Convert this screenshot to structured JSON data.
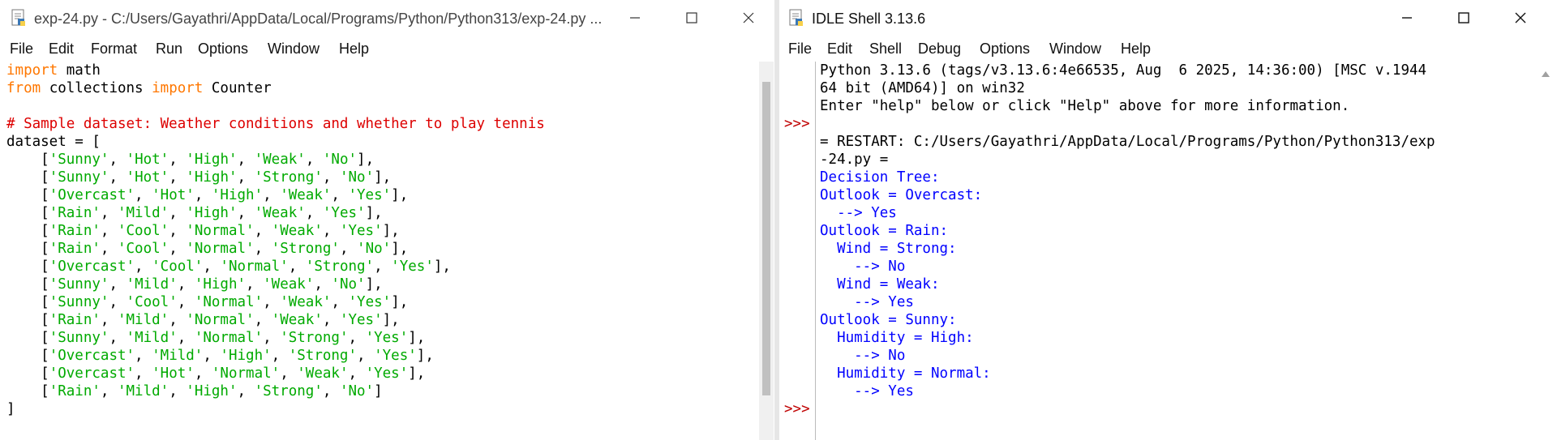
{
  "editor": {
    "title": "exp-24.py - C:/Users/Gayathri/AppData/Local/Programs/Python/Python313/exp-24.py ...",
    "menu": [
      "File",
      "Edit",
      "Format",
      "Run",
      "Options",
      "Window",
      "Help"
    ],
    "code_lines": [
      [
        {
          "t": "import",
          "c": "kw"
        },
        {
          "t": " math",
          "c": "def"
        }
      ],
      [
        {
          "t": "from",
          "c": "kw"
        },
        {
          "t": " collections ",
          "c": "def"
        },
        {
          "t": "import",
          "c": "kw"
        },
        {
          "t": " Counter",
          "c": "def"
        }
      ],
      [],
      [
        {
          "t": "# Sample dataset: Weather conditions and whether to play tennis",
          "c": "cm"
        }
      ],
      [
        {
          "t": "dataset = [",
          "c": "def"
        }
      ],
      [
        {
          "t": "    [",
          "c": "def"
        },
        {
          "t": "'Sunny'",
          "c": "str"
        },
        {
          "t": ", ",
          "c": "def"
        },
        {
          "t": "'Hot'",
          "c": "str"
        },
        {
          "t": ", ",
          "c": "def"
        },
        {
          "t": "'High'",
          "c": "str"
        },
        {
          "t": ", ",
          "c": "def"
        },
        {
          "t": "'Weak'",
          "c": "str"
        },
        {
          "t": ", ",
          "c": "def"
        },
        {
          "t": "'No'",
          "c": "str"
        },
        {
          "t": "],",
          "c": "def"
        }
      ],
      [
        {
          "t": "    [",
          "c": "def"
        },
        {
          "t": "'Sunny'",
          "c": "str"
        },
        {
          "t": ", ",
          "c": "def"
        },
        {
          "t": "'Hot'",
          "c": "str"
        },
        {
          "t": ", ",
          "c": "def"
        },
        {
          "t": "'High'",
          "c": "str"
        },
        {
          "t": ", ",
          "c": "def"
        },
        {
          "t": "'Strong'",
          "c": "str"
        },
        {
          "t": ", ",
          "c": "def"
        },
        {
          "t": "'No'",
          "c": "str"
        },
        {
          "t": "],",
          "c": "def"
        }
      ],
      [
        {
          "t": "    [",
          "c": "def"
        },
        {
          "t": "'Overcast'",
          "c": "str"
        },
        {
          "t": ", ",
          "c": "def"
        },
        {
          "t": "'Hot'",
          "c": "str"
        },
        {
          "t": ", ",
          "c": "def"
        },
        {
          "t": "'High'",
          "c": "str"
        },
        {
          "t": ", ",
          "c": "def"
        },
        {
          "t": "'Weak'",
          "c": "str"
        },
        {
          "t": ", ",
          "c": "def"
        },
        {
          "t": "'Yes'",
          "c": "str"
        },
        {
          "t": "],",
          "c": "def"
        }
      ],
      [
        {
          "t": "    [",
          "c": "def"
        },
        {
          "t": "'Rain'",
          "c": "str"
        },
        {
          "t": ", ",
          "c": "def"
        },
        {
          "t": "'Mild'",
          "c": "str"
        },
        {
          "t": ", ",
          "c": "def"
        },
        {
          "t": "'High'",
          "c": "str"
        },
        {
          "t": ", ",
          "c": "def"
        },
        {
          "t": "'Weak'",
          "c": "str"
        },
        {
          "t": ", ",
          "c": "def"
        },
        {
          "t": "'Yes'",
          "c": "str"
        },
        {
          "t": "],",
          "c": "def"
        }
      ],
      [
        {
          "t": "    [",
          "c": "def"
        },
        {
          "t": "'Rain'",
          "c": "str"
        },
        {
          "t": ", ",
          "c": "def"
        },
        {
          "t": "'Cool'",
          "c": "str"
        },
        {
          "t": ", ",
          "c": "def"
        },
        {
          "t": "'Normal'",
          "c": "str"
        },
        {
          "t": ", ",
          "c": "def"
        },
        {
          "t": "'Weak'",
          "c": "str"
        },
        {
          "t": ", ",
          "c": "def"
        },
        {
          "t": "'Yes'",
          "c": "str"
        },
        {
          "t": "],",
          "c": "def"
        }
      ],
      [
        {
          "t": "    [",
          "c": "def"
        },
        {
          "t": "'Rain'",
          "c": "str"
        },
        {
          "t": ", ",
          "c": "def"
        },
        {
          "t": "'Cool'",
          "c": "str"
        },
        {
          "t": ", ",
          "c": "def"
        },
        {
          "t": "'Normal'",
          "c": "str"
        },
        {
          "t": ", ",
          "c": "def"
        },
        {
          "t": "'Strong'",
          "c": "str"
        },
        {
          "t": ", ",
          "c": "def"
        },
        {
          "t": "'No'",
          "c": "str"
        },
        {
          "t": "],",
          "c": "def"
        }
      ],
      [
        {
          "t": "    [",
          "c": "def"
        },
        {
          "t": "'Overcast'",
          "c": "str"
        },
        {
          "t": ", ",
          "c": "def"
        },
        {
          "t": "'Cool'",
          "c": "str"
        },
        {
          "t": ", ",
          "c": "def"
        },
        {
          "t": "'Normal'",
          "c": "str"
        },
        {
          "t": ", ",
          "c": "def"
        },
        {
          "t": "'Strong'",
          "c": "str"
        },
        {
          "t": ", ",
          "c": "def"
        },
        {
          "t": "'Yes'",
          "c": "str"
        },
        {
          "t": "],",
          "c": "def"
        }
      ],
      [
        {
          "t": "    [",
          "c": "def"
        },
        {
          "t": "'Sunny'",
          "c": "str"
        },
        {
          "t": ", ",
          "c": "def"
        },
        {
          "t": "'Mild'",
          "c": "str"
        },
        {
          "t": ", ",
          "c": "def"
        },
        {
          "t": "'High'",
          "c": "str"
        },
        {
          "t": ", ",
          "c": "def"
        },
        {
          "t": "'Weak'",
          "c": "str"
        },
        {
          "t": ", ",
          "c": "def"
        },
        {
          "t": "'No'",
          "c": "str"
        },
        {
          "t": "],",
          "c": "def"
        }
      ],
      [
        {
          "t": "    [",
          "c": "def"
        },
        {
          "t": "'Sunny'",
          "c": "str"
        },
        {
          "t": ", ",
          "c": "def"
        },
        {
          "t": "'Cool'",
          "c": "str"
        },
        {
          "t": ", ",
          "c": "def"
        },
        {
          "t": "'Normal'",
          "c": "str"
        },
        {
          "t": ", ",
          "c": "def"
        },
        {
          "t": "'Weak'",
          "c": "str"
        },
        {
          "t": ", ",
          "c": "def"
        },
        {
          "t": "'Yes'",
          "c": "str"
        },
        {
          "t": "],",
          "c": "def"
        }
      ],
      [
        {
          "t": "    [",
          "c": "def"
        },
        {
          "t": "'Rain'",
          "c": "str"
        },
        {
          "t": ", ",
          "c": "def"
        },
        {
          "t": "'Mild'",
          "c": "str"
        },
        {
          "t": ", ",
          "c": "def"
        },
        {
          "t": "'Normal'",
          "c": "str"
        },
        {
          "t": ", ",
          "c": "def"
        },
        {
          "t": "'Weak'",
          "c": "str"
        },
        {
          "t": ", ",
          "c": "def"
        },
        {
          "t": "'Yes'",
          "c": "str"
        },
        {
          "t": "],",
          "c": "def"
        }
      ],
      [
        {
          "t": "    [",
          "c": "def"
        },
        {
          "t": "'Sunny'",
          "c": "str"
        },
        {
          "t": ", ",
          "c": "def"
        },
        {
          "t": "'Mild'",
          "c": "str"
        },
        {
          "t": ", ",
          "c": "def"
        },
        {
          "t": "'Normal'",
          "c": "str"
        },
        {
          "t": ", ",
          "c": "def"
        },
        {
          "t": "'Strong'",
          "c": "str"
        },
        {
          "t": ", ",
          "c": "def"
        },
        {
          "t": "'Yes'",
          "c": "str"
        },
        {
          "t": "],",
          "c": "def"
        }
      ],
      [
        {
          "t": "    [",
          "c": "def"
        },
        {
          "t": "'Overcast'",
          "c": "str"
        },
        {
          "t": ", ",
          "c": "def"
        },
        {
          "t": "'Mild'",
          "c": "str"
        },
        {
          "t": ", ",
          "c": "def"
        },
        {
          "t": "'High'",
          "c": "str"
        },
        {
          "t": ", ",
          "c": "def"
        },
        {
          "t": "'Strong'",
          "c": "str"
        },
        {
          "t": ", ",
          "c": "def"
        },
        {
          "t": "'Yes'",
          "c": "str"
        },
        {
          "t": "],",
          "c": "def"
        }
      ],
      [
        {
          "t": "    [",
          "c": "def"
        },
        {
          "t": "'Overcast'",
          "c": "str"
        },
        {
          "t": ", ",
          "c": "def"
        },
        {
          "t": "'Hot'",
          "c": "str"
        },
        {
          "t": ", ",
          "c": "def"
        },
        {
          "t": "'Normal'",
          "c": "str"
        },
        {
          "t": ", ",
          "c": "def"
        },
        {
          "t": "'Weak'",
          "c": "str"
        },
        {
          "t": ", ",
          "c": "def"
        },
        {
          "t": "'Yes'",
          "c": "str"
        },
        {
          "t": "],",
          "c": "def"
        }
      ],
      [
        {
          "t": "    [",
          "c": "def"
        },
        {
          "t": "'Rain'",
          "c": "str"
        },
        {
          "t": ", ",
          "c": "def"
        },
        {
          "t": "'Mild'",
          "c": "str"
        },
        {
          "t": ", ",
          "c": "def"
        },
        {
          "t": "'High'",
          "c": "str"
        },
        {
          "t": ", ",
          "c": "def"
        },
        {
          "t": "'Strong'",
          "c": "str"
        },
        {
          "t": ", ",
          "c": "def"
        },
        {
          "t": "'No'",
          "c": "str"
        },
        {
          "t": "]",
          "c": "def"
        }
      ],
      [
        {
          "t": "]",
          "c": "def"
        }
      ]
    ]
  },
  "shell": {
    "title": "IDLE Shell 3.13.6",
    "menu": [
      "File",
      "Edit",
      "Shell",
      "Debug",
      "Options",
      "Window",
      "Help"
    ],
    "prompt": ">>>",
    "lines": [
      {
        "p": "",
        "t": "Python 3.13.6 (tags/v3.13.6:4e66535, Aug  6 2025, 14:36:00) [MSC v.1944",
        "c": "def"
      },
      {
        "p": "",
        "t": "64 bit (AMD64)] on win32",
        "c": "def"
      },
      {
        "p": "",
        "t": "Enter \"help\" below or click \"Help\" above for more information.",
        "c": "def"
      },
      {
        "p": ">>>",
        "t": "",
        "c": "def"
      },
      {
        "p": "",
        "t": "= RESTART: C:/Users/Gayathri/AppData/Local/Programs/Python/Python313/exp",
        "c": "def"
      },
      {
        "p": "",
        "t": "-24.py =",
        "c": "def"
      },
      {
        "p": "",
        "t": "Decision Tree:",
        "c": "out"
      },
      {
        "p": "",
        "t": "Outlook = Overcast:",
        "c": "out"
      },
      {
        "p": "",
        "t": "  --> Yes",
        "c": "out"
      },
      {
        "p": "",
        "t": "Outlook = Rain:",
        "c": "out"
      },
      {
        "p": "",
        "t": "  Wind = Strong:",
        "c": "out"
      },
      {
        "p": "",
        "t": "    --> No",
        "c": "out"
      },
      {
        "p": "",
        "t": "  Wind = Weak:",
        "c": "out"
      },
      {
        "p": "",
        "t": "    --> Yes",
        "c": "out"
      },
      {
        "p": "",
        "t": "Outlook = Sunny:",
        "c": "out"
      },
      {
        "p": "",
        "t": "  Humidity = High:",
        "c": "out"
      },
      {
        "p": "",
        "t": "    --> No",
        "c": "out"
      },
      {
        "p": "",
        "t": "  Humidity = Normal:",
        "c": "out"
      },
      {
        "p": "",
        "t": "    --> Yes",
        "c": "out"
      },
      {
        "p": ">>>",
        "t": "",
        "c": "def"
      }
    ]
  },
  "colors": {
    "keyword": "#ff7700",
    "string": "#00aa00",
    "comment": "#dd0000",
    "output": "#0000ff",
    "prompt": "#c00000"
  },
  "icons": {
    "file_icon": "python-file-icon",
    "minimize": "minimize-icon",
    "maximize": "maximize-icon",
    "close": "close-icon"
  }
}
